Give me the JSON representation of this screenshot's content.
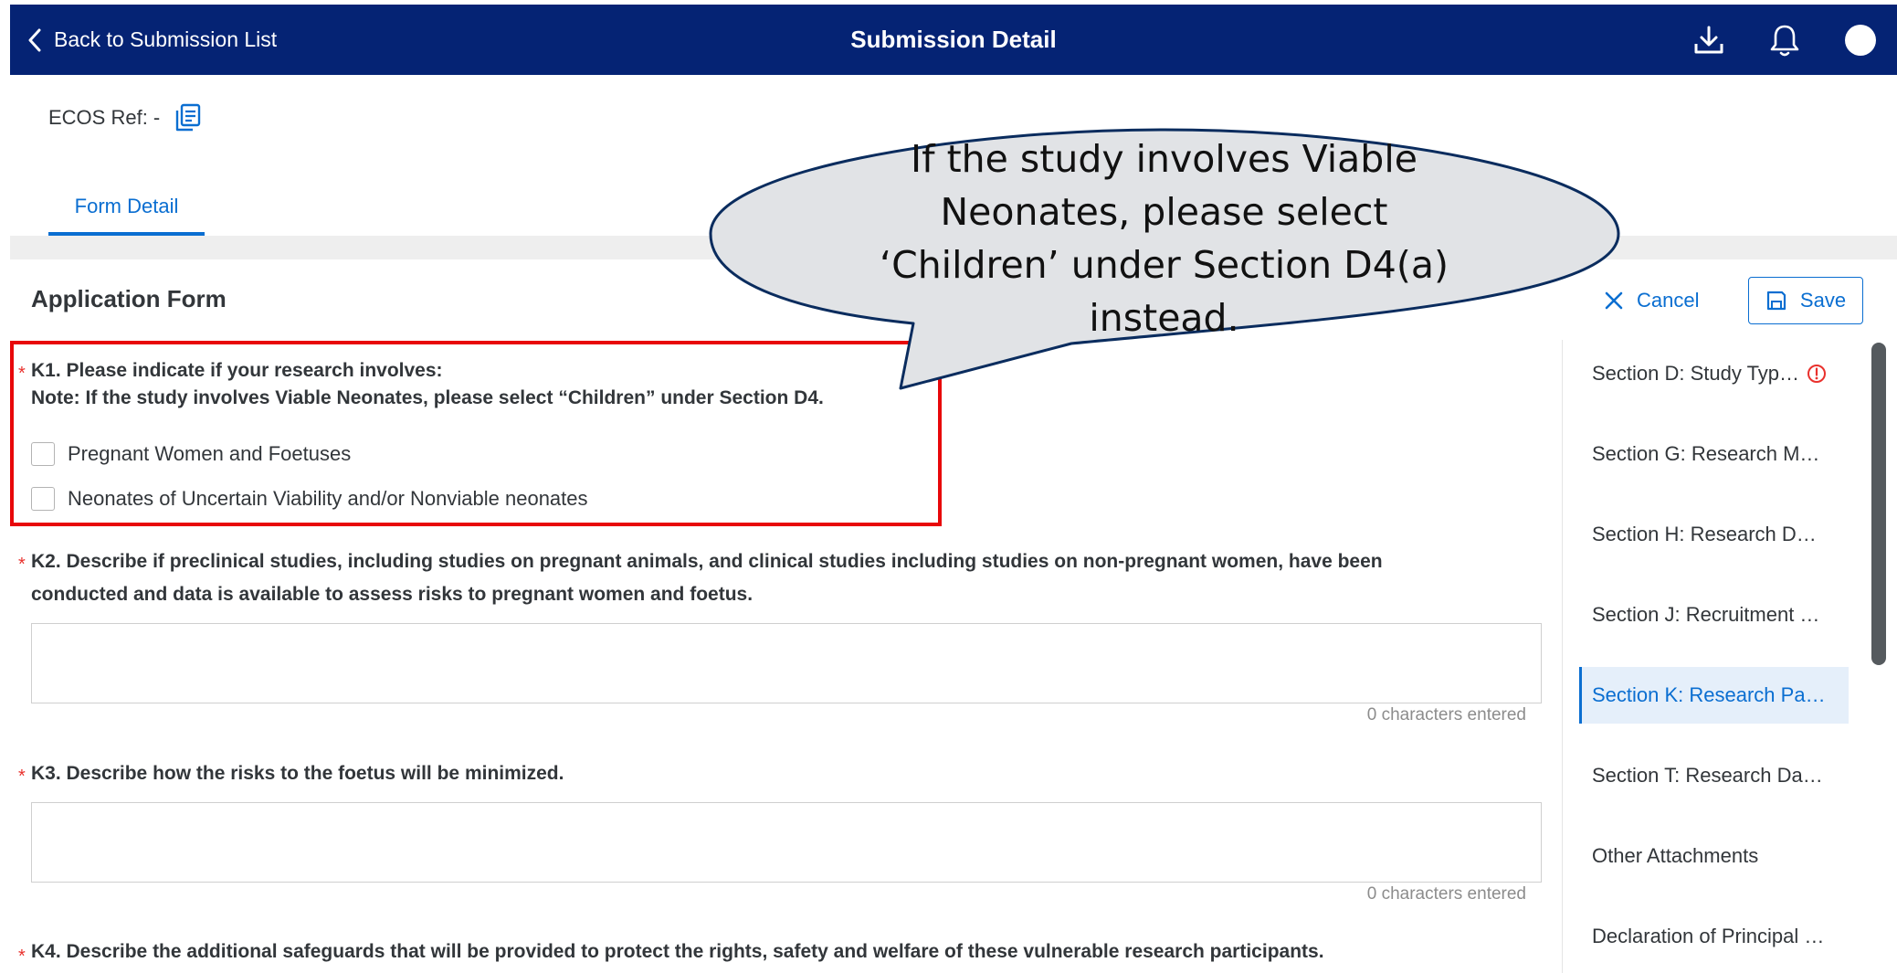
{
  "header": {
    "back_label": "Back to Submission List",
    "title": "Submission Detail",
    "icons": [
      "download-icon",
      "bell-icon",
      "avatar"
    ]
  },
  "ecos": {
    "label": "ECOS Ref: -"
  },
  "tabs": [
    {
      "label": "Form Detail",
      "active": true
    }
  ],
  "form": {
    "title": "Application Form",
    "cancel_label": "Cancel",
    "save_label": "Save",
    "k1": {
      "question": "K1. Please indicate if your research involves:",
      "note": "Note: If the study involves Viable Neonates, please select “Children” under Section D4.",
      "options": [
        {
          "label": "Pregnant Women and Foetuses",
          "checked": false
        },
        {
          "label": "Neonates of Uncertain Viability and/or Nonviable neonates",
          "checked": false
        }
      ]
    },
    "k2": {
      "question_line1": "K2. Describe if preclinical studies, including studies on pregnant animals, and clinical studies including studies on non-pregnant women, have been",
      "question_line2": "conducted and data is available to assess risks to pregnant women and foetus.",
      "char_count": "0 characters entered"
    },
    "k3": {
      "question": "K3. Describe how the risks to the foetus will be minimized.",
      "char_count": "0 characters entered"
    },
    "k4": {
      "question": "K4. Describe the additional safeguards that will be provided to protect the rights, safety and welfare of these vulnerable research participants."
    },
    "required_marker": "*"
  },
  "sidebar": {
    "items": [
      {
        "label": "Section D: Study Typ…",
        "warning": true,
        "active": false
      },
      {
        "label": "Section G: Research M…",
        "warning": false,
        "active": false
      },
      {
        "label": "Section H: Research D…",
        "warning": false,
        "active": false
      },
      {
        "label": "Section J: Recruitment …",
        "warning": false,
        "active": false
      },
      {
        "label": "Section K: Research Pa…",
        "warning": false,
        "active": true
      },
      {
        "label": "Section T: Research Da…",
        "warning": false,
        "active": false
      },
      {
        "label": "Other Attachments",
        "warning": false,
        "active": false
      },
      {
        "label": "Declaration of Principal …",
        "warning": false,
        "active": false
      }
    ]
  },
  "callout": {
    "text_lines": [
      "If the study involves Viable",
      "Neonates, please select",
      "‘Children’ under Section D4(a)",
      "instead."
    ]
  },
  "colors": {
    "header_bg": "#052374",
    "accent": "#0a6ed1",
    "highlight": "#e8070a",
    "required": "#e9312d",
    "callout_fill": "#e1e3e6",
    "callout_stroke": "#0a2c5e"
  }
}
